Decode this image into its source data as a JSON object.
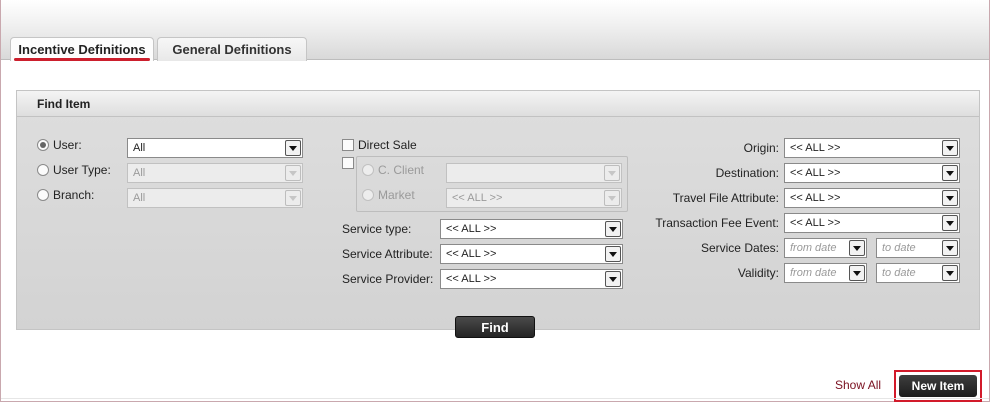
{
  "tabs": [
    {
      "label": "Incentive Definitions",
      "active": true
    },
    {
      "label": "General Definitions",
      "active": false
    }
  ],
  "find_panel": {
    "title": "Find Item",
    "owner": {
      "user_label": "User:",
      "user_value": "All",
      "user_type_label": "User Type:",
      "user_type_value": "All",
      "branch_label": "Branch:",
      "branch_value": "All",
      "selected": "User"
    },
    "direct_sale_label": "Direct Sale",
    "client_label": "C. Client",
    "client_value": "",
    "market_label": "Market",
    "market_value": "<< ALL >>",
    "service_type_label": "Service type:",
    "service_type_value": "<< ALL >>",
    "service_attribute_label": "Service Attribute:",
    "service_attribute_value": "<< ALL >>",
    "service_provider_label": "Service Provider:",
    "service_provider_value": "<< ALL >>",
    "origin_label": "Origin:",
    "origin_value": "<< ALL >>",
    "destination_label": "Destination:",
    "destination_value": "<< ALL >>",
    "travel_file_attribute_label": "Travel File Attribute:",
    "travel_file_attribute_value": "<< ALL >>",
    "transaction_fee_event_label": "Transaction Fee Event:",
    "transaction_fee_event_value": "<< ALL >>",
    "service_dates_label": "Service Dates:",
    "validity_label": "Validity:",
    "from_date_placeholder": "from date",
    "to_date_placeholder": "to date",
    "find_label": "Find"
  },
  "footer": {
    "show_all_label": "Show All",
    "new_item_label": "New Item"
  },
  "colors": {
    "accent_red": "#d21a2a",
    "button_dark": "#242424",
    "link": "#7a1020"
  }
}
